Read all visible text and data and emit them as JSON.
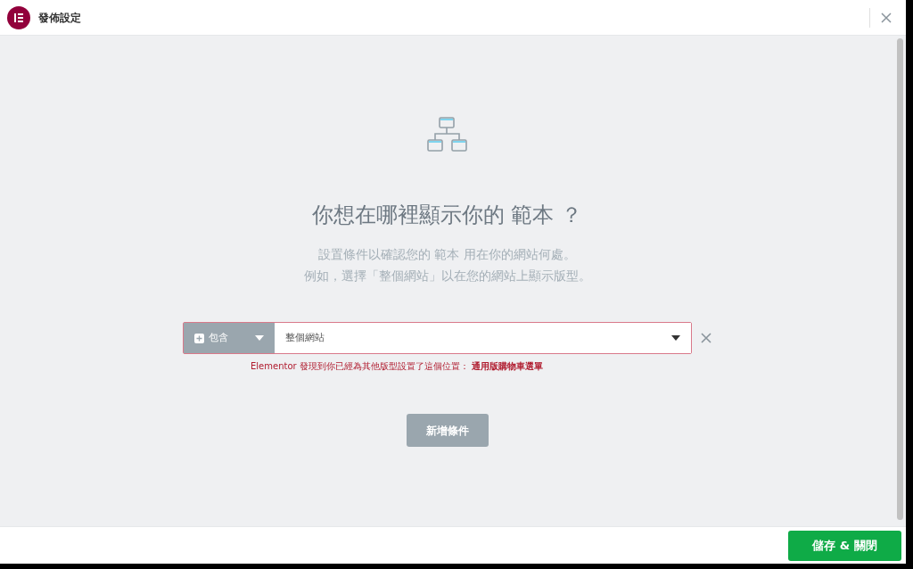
{
  "window": {
    "title": "發佈設定"
  },
  "heading": "你想在哪裡顯示你的 範本 ？",
  "description": [
    "設置條件以確認您的 範本 用在你的網站何處。",
    "例如，選擇「整個網站」以在您的網站上顯示版型。"
  ],
  "conditions": [
    {
      "type": "包含",
      "value": "整個網站",
      "error": "Elementor 發現到你已經為其他版型設置了這個位置： **通用版購物車選單**"
    }
  ],
  "add_button": "新增條件",
  "save_button": "儲存 & 關閉"
}
